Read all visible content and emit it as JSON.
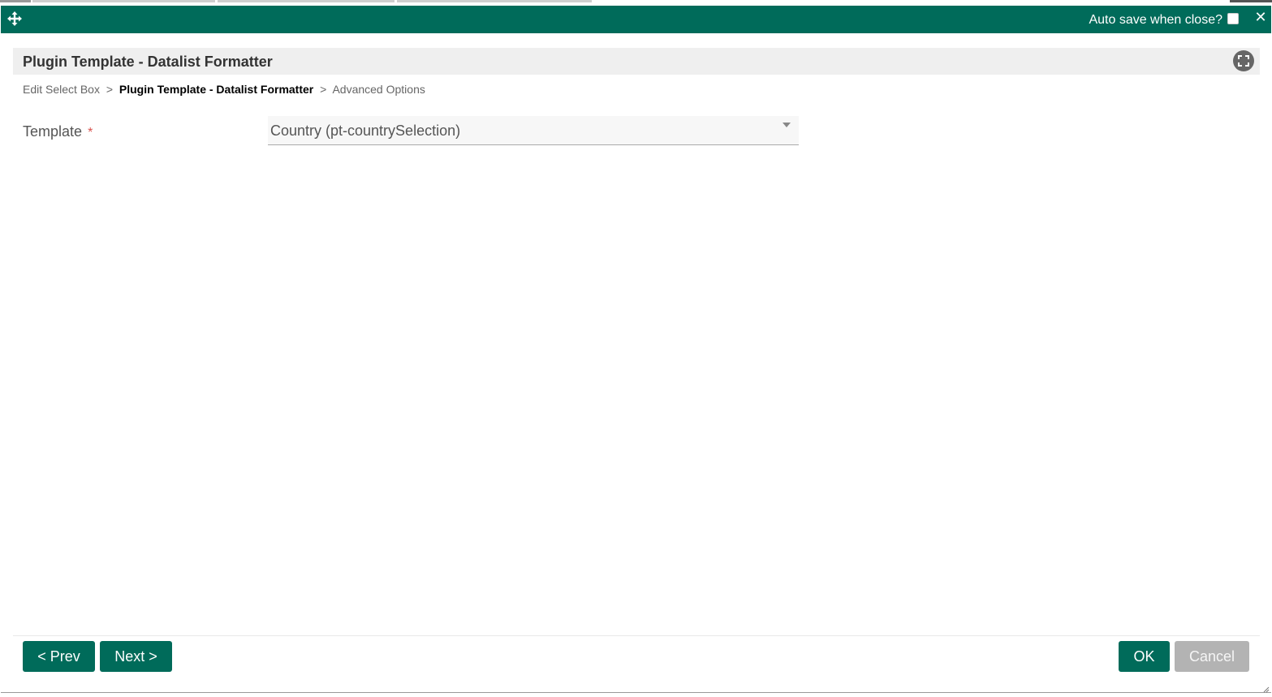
{
  "titlebar": {
    "autosave_label": "Auto save when close?",
    "autosave_checked": false,
    "close_glyph": "✕"
  },
  "header": {
    "title": "Plugin Template - Datalist Formatter"
  },
  "breadcrumb": {
    "items": [
      "Edit Select Box",
      "Plugin Template - Datalist Formatter",
      "Advanced Options"
    ],
    "separator": ">",
    "current_index": 1
  },
  "form": {
    "template_label": "Template",
    "required_marker": "*",
    "template_value": "Country (pt-countrySelection)"
  },
  "buttons": {
    "prev": "< Prev",
    "next": "Next >",
    "ok": "OK",
    "cancel": "Cancel"
  },
  "colors": {
    "accent": "#006b5a",
    "header_bg": "#efefef",
    "required": "#d9534f",
    "disabled_button": "#b3b3b3"
  },
  "icons": {
    "move": "move-icon",
    "close": "close-icon",
    "fullscreen": "fullscreen-icon",
    "dropdown": "chevron-down-icon",
    "resize": "resize-grip-icon"
  }
}
